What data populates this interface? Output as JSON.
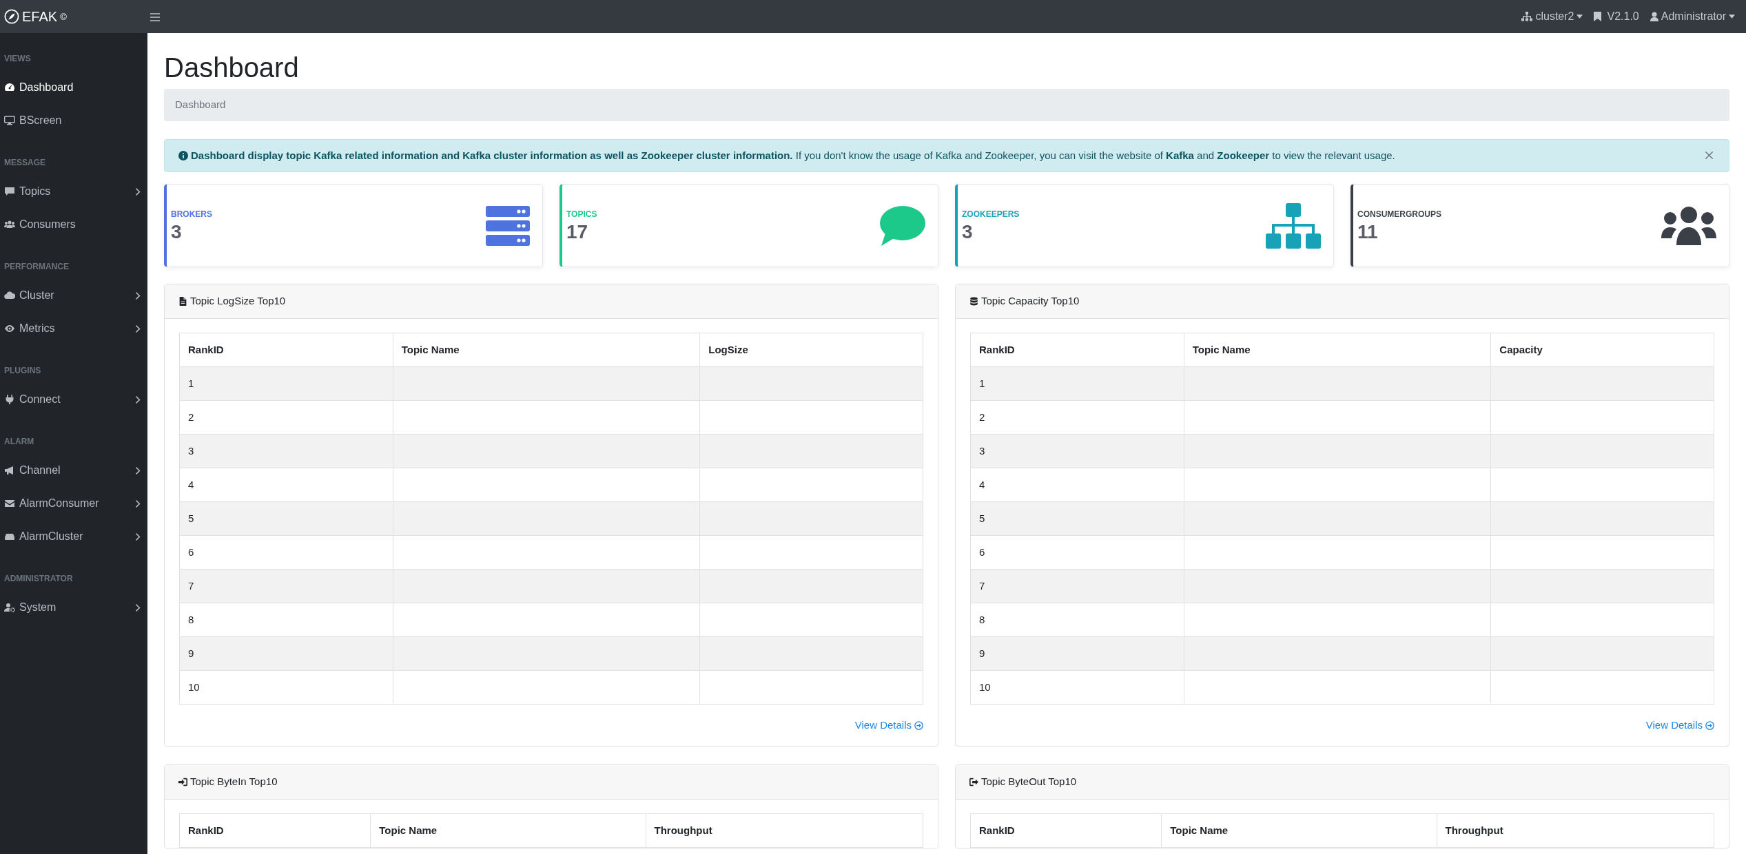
{
  "brand": {
    "name": "EFAK",
    "mark": "©"
  },
  "topbar": {
    "cluster": "cluster2",
    "version": "V2.1.0",
    "user": "Administrator"
  },
  "sidebar": {
    "sections": [
      {
        "heading": "VIEWS",
        "items": [
          {
            "label": "Dashboard",
            "selected": true,
            "expandable": false
          },
          {
            "label": "BScreen",
            "selected": false,
            "expandable": false
          }
        ]
      },
      {
        "heading": "MESSAGE",
        "items": [
          {
            "label": "Topics",
            "selected": false,
            "expandable": true
          },
          {
            "label": "Consumers",
            "selected": false,
            "expandable": false
          }
        ]
      },
      {
        "heading": "PERFORMANCE",
        "items": [
          {
            "label": "Cluster",
            "selected": false,
            "expandable": true
          },
          {
            "label": "Metrics",
            "selected": false,
            "expandable": true
          }
        ]
      },
      {
        "heading": "PLUGINS",
        "items": [
          {
            "label": "Connect",
            "selected": false,
            "expandable": true
          }
        ]
      },
      {
        "heading": "ALARM",
        "items": [
          {
            "label": "Channel",
            "selected": false,
            "expandable": true
          },
          {
            "label": "AlarmConsumer",
            "selected": false,
            "expandable": true
          },
          {
            "label": "AlarmCluster",
            "selected": false,
            "expandable": true
          }
        ]
      },
      {
        "heading": "ADMINISTRATOR",
        "items": [
          {
            "label": "System",
            "selected": false,
            "expandable": true
          }
        ]
      }
    ]
  },
  "page_title": "Dashboard",
  "breadcrumb": [
    "Dashboard"
  ],
  "alert": {
    "text": "**Dashboard display topic Kafka related information and Kafka cluster information as well as Zookeeper cluster information.** If you don't know the usage of Kafka and Zookeeper, you can visit the website of **Kafka** and **Zookeeper** to view the relevant usage.",
    "dismissible": true
  },
  "stat_cards": [
    {
      "label": "BROKERS",
      "value": "3",
      "color": "#4e73df"
    },
    {
      "label": "TOPICS",
      "value": "17",
      "color": "#1cc88a"
    },
    {
      "label": "ZOOKEEPERS",
      "value": "3",
      "color": "#17a2b8"
    },
    {
      "label": "CONSUMERGROUPS",
      "value": "11",
      "color": "#3a3f48"
    }
  ],
  "panels": [
    {
      "title": "Topic LogSize Top10",
      "columns": [
        "RankID",
        "Topic Name",
        "LogSize"
      ],
      "rows": [
        {
          "rank": "1"
        },
        {
          "rank": "2"
        },
        {
          "rank": "3"
        },
        {
          "rank": "4"
        },
        {
          "rank": "5"
        },
        {
          "rank": "6"
        },
        {
          "rank": "7"
        },
        {
          "rank": "8"
        },
        {
          "rank": "9"
        },
        {
          "rank": "10"
        }
      ],
      "link": "View Details"
    },
    {
      "title": "Topic Capacity Top10",
      "columns": [
        "RankID",
        "Topic Name",
        "Capacity"
      ],
      "rows": [
        {
          "rank": "1"
        },
        {
          "rank": "2"
        },
        {
          "rank": "3"
        },
        {
          "rank": "4"
        },
        {
          "rank": "5"
        },
        {
          "rank": "6"
        },
        {
          "rank": "7"
        },
        {
          "rank": "8"
        },
        {
          "rank": "9"
        },
        {
          "rank": "10"
        }
      ],
      "link": "View Details"
    },
    {
      "title": "Topic ByteIn Top10",
      "columns": [
        "RankID",
        "Topic Name",
        "Throughput"
      ]
    },
    {
      "title": "Topic ByteOut Top10",
      "columns": [
        "RankID",
        "Topic Name",
        "Throughput"
      ]
    }
  ]
}
